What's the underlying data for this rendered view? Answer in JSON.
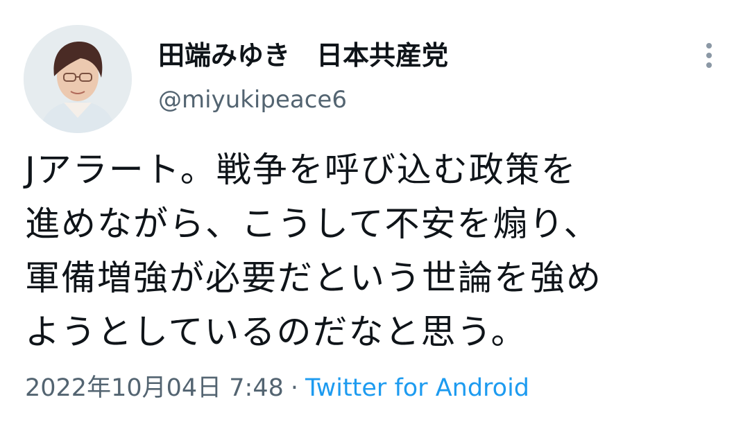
{
  "author": {
    "display_name": "田端みゆき　日本共産党",
    "handle": "@miyukipeace6"
  },
  "tweet": {
    "text": "Jアラート。戦争を呼び込む政策を\n進めながら、こうして不安を煽り、\n軍備増強が必要だという世論を強め\nようとしているのだなと思う。",
    "timestamp": "2022年10月04日 7:48",
    "separator": "·",
    "source": "Twitter for Android"
  },
  "icons": {
    "more": "more-vertical-icon"
  },
  "colors": {
    "text": "#0f1419",
    "secondary": "#536471",
    "link": "#1d9bf0"
  }
}
